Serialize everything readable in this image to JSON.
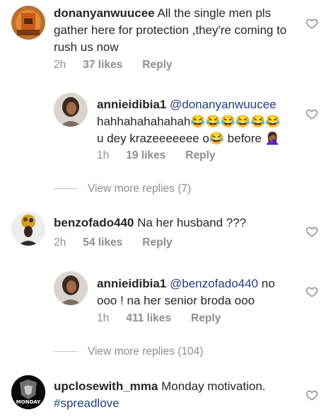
{
  "comments": [
    {
      "username": "donanyanwuucee",
      "text": " All the single men pls gather here for protection ,they're coming to rush us now",
      "time": "2h",
      "likes": "37 likes",
      "reply": "Reply"
    },
    {
      "username": "annieidibia1",
      "mention": "@donanyanwuucee",
      "text_line1": "hahhahahahahah😂😂😂😂😂😂",
      "text_line2": "u dey krazeeeeeee o😂 before 🤦🏾‍♀️",
      "time": "1h",
      "likes": "19 likes",
      "reply": "Reply"
    },
    {
      "view_more": "View more replies (7)"
    },
    {
      "username": "benzofado440",
      "text": " Na her husband ???",
      "time": "2h",
      "likes": "54 likes",
      "reply": "Reply"
    },
    {
      "username": "annieidibia1",
      "mention": "@benzofado440",
      "text_line1_tail": " no",
      "text_line2": "ooo ! na her senior broda ooo",
      "time": "1h",
      "likes": "411 likes",
      "reply": "Reply"
    },
    {
      "view_more": "View more replies (104)"
    },
    {
      "username": "upclosewith_mma",
      "text": " Monday motivation.",
      "hashtag": "#spreadlove",
      "avatar_label": "MONDAY"
    }
  ],
  "colors": {
    "text": "#262626",
    "meta": "#8e8e8e",
    "link": "#1f3f7a"
  },
  "icons": [
    "heart-icon"
  ]
}
